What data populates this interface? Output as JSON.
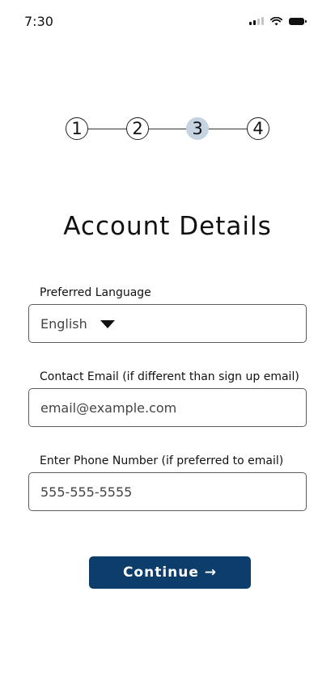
{
  "status_bar": {
    "time": "7:30"
  },
  "stepper": {
    "steps": [
      "1",
      "2",
      "3",
      "4"
    ],
    "active_step": 3
  },
  "form": {
    "title": "Account Details",
    "language": {
      "label": "Preferred Language",
      "value": "English"
    },
    "email": {
      "label": "Contact Email (if different than sign up email)",
      "placeholder": "email@example.com"
    },
    "phone": {
      "label": "Enter Phone Number (if preferred to email)",
      "placeholder": "555-555-5555"
    },
    "continue_label": "Continue →"
  },
  "colors": {
    "active_step": "#c6d3e1",
    "primary_button": "#0d3d6b"
  }
}
